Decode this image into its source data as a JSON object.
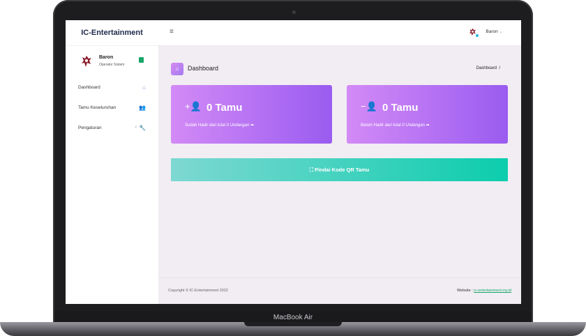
{
  "device": {
    "label": "MacBook Air"
  },
  "app": {
    "brand": "IC-Entertainment"
  },
  "sidebar": {
    "user": {
      "name": "Baron",
      "role": "Operator Sistem"
    },
    "items": [
      {
        "label": "Dashboard",
        "icon": "home-icon"
      },
      {
        "label": "Tamu Keseluruhan",
        "icon": "users-icon"
      },
      {
        "label": "Pengaturan",
        "icon": "wrench-icon"
      }
    ]
  },
  "topbar": {
    "username": "Baron"
  },
  "page": {
    "title": "Dashboard",
    "breadcrumb": "Dashboard"
  },
  "cards": [
    {
      "value": "0 Tamu",
      "label": "Sudah Hadir",
      "detail": "dari total 0 Undangan",
      "icon": "user-plus-icon"
    },
    {
      "value": "0 Tamu",
      "label": "Belum Hadir",
      "detail": "dari total 0 Undangan",
      "icon": "user-minus-icon"
    }
  ],
  "scan_button": {
    "label": "Pindai Kode QR Tamu"
  },
  "footer": {
    "copyright": "Copyright © IC-Entertainment 2022",
    "website_label": "Website :",
    "website_url": "ic-entertainment.my.id"
  },
  "colors": {
    "accent": "#a47af0",
    "card_start": "#d38af6",
    "card_end": "#9a5cf0",
    "scan_start": "#7ed8d2",
    "scan_end": "#0ccdad",
    "brand_text": "#1f2a4d"
  }
}
